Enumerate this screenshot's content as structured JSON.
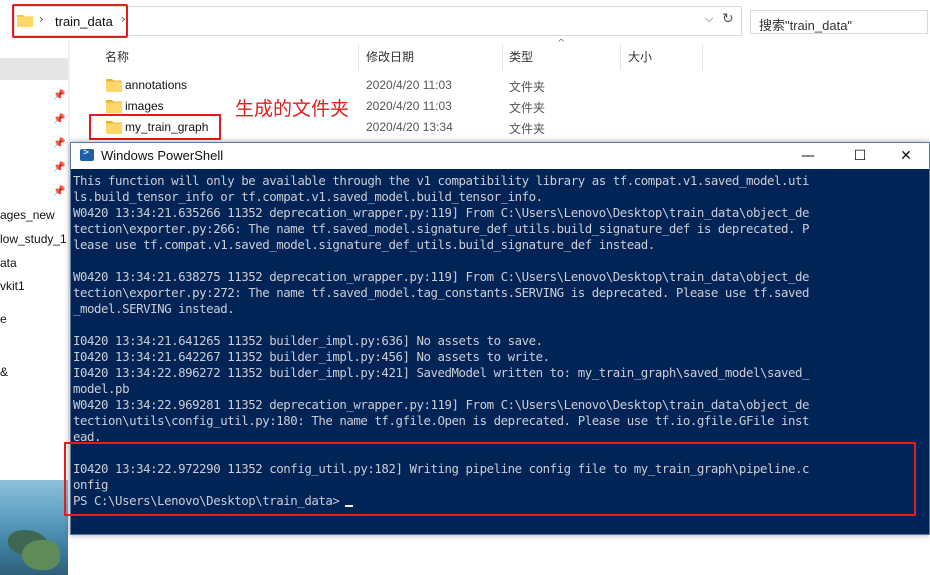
{
  "explorer": {
    "address": {
      "path": "train_data"
    },
    "search": {
      "placeholder": "搜索\"train_data\""
    },
    "nav_labels": [
      "ages_new",
      "low_study_1",
      "ata",
      "vkit1",
      "e",
      "&"
    ],
    "columns": {
      "name": "名称",
      "modified": "修改日期",
      "type": "类型",
      "size": "大小"
    },
    "files": [
      {
        "name": "annotations",
        "date": "2020/4/20 11:03",
        "type": "文件夹"
      },
      {
        "name": "images",
        "date": "2020/4/20 11:03",
        "type": "文件夹"
      },
      {
        "name": "my_train_graph",
        "date": "2020/4/20 13:34",
        "type": "文件夹"
      }
    ],
    "annotation_text": "生成的文件夹"
  },
  "powershell": {
    "title": "Windows PowerShell",
    "buttons": {
      "minimize": "—",
      "maximize": "☐",
      "close": "✕"
    },
    "lines": [
      "This function will only be available through the v1 compatibility library as tf.compat.v1.saved_model.uti",
      "ls.build_tensor_info or tf.compat.v1.saved_model.build_tensor_info.",
      "W0420 13:34:21.635266 11352 deprecation_wrapper.py:119] From C:\\Users\\Lenovo\\Desktop\\train_data\\object_de",
      "tection\\exporter.py:266: The name tf.saved_model.signature_def_utils.build_signature_def is deprecated. P",
      "lease use tf.compat.v1.saved_model.signature_def_utils.build_signature_def instead.",
      "",
      "W0420 13:34:21.638275 11352 deprecation_wrapper.py:119] From C:\\Users\\Lenovo\\Desktop\\train_data\\object_de",
      "tection\\exporter.py:272: The name tf.saved_model.tag_constants.SERVING is deprecated. Please use tf.saved",
      "_model.SERVING instead.",
      "",
      "I0420 13:34:21.641265 11352 builder_impl.py:636] No assets to save.",
      "I0420 13:34:21.642267 11352 builder_impl.py:456] No assets to write.",
      "I0420 13:34:22.896272 11352 builder_impl.py:421] SavedModel written to: my_train_graph\\saved_model\\saved_",
      "model.pb",
      "W0420 13:34:22.969281 11352 deprecation_wrapper.py:119] From C:\\Users\\Lenovo\\Desktop\\train_data\\object_de",
      "tection\\utils\\config_util.py:180: The name tf.gfile.Open is deprecated. Please use tf.io.gfile.GFile inst",
      "ead.",
      "",
      "I0420 13:34:22.972290 11352 config_util.py:182] Writing pipeline config file to my_train_graph\\pipeline.c",
      "onfig"
    ],
    "prompt": "PS C:\\Users\\Lenovo\\Desktop\\train_data>"
  },
  "colors": {
    "console_bg": "#012456",
    "console_text": "#ccccd6",
    "highlight_red": "#e21d1d",
    "folder_yellow": "#f5c542"
  }
}
